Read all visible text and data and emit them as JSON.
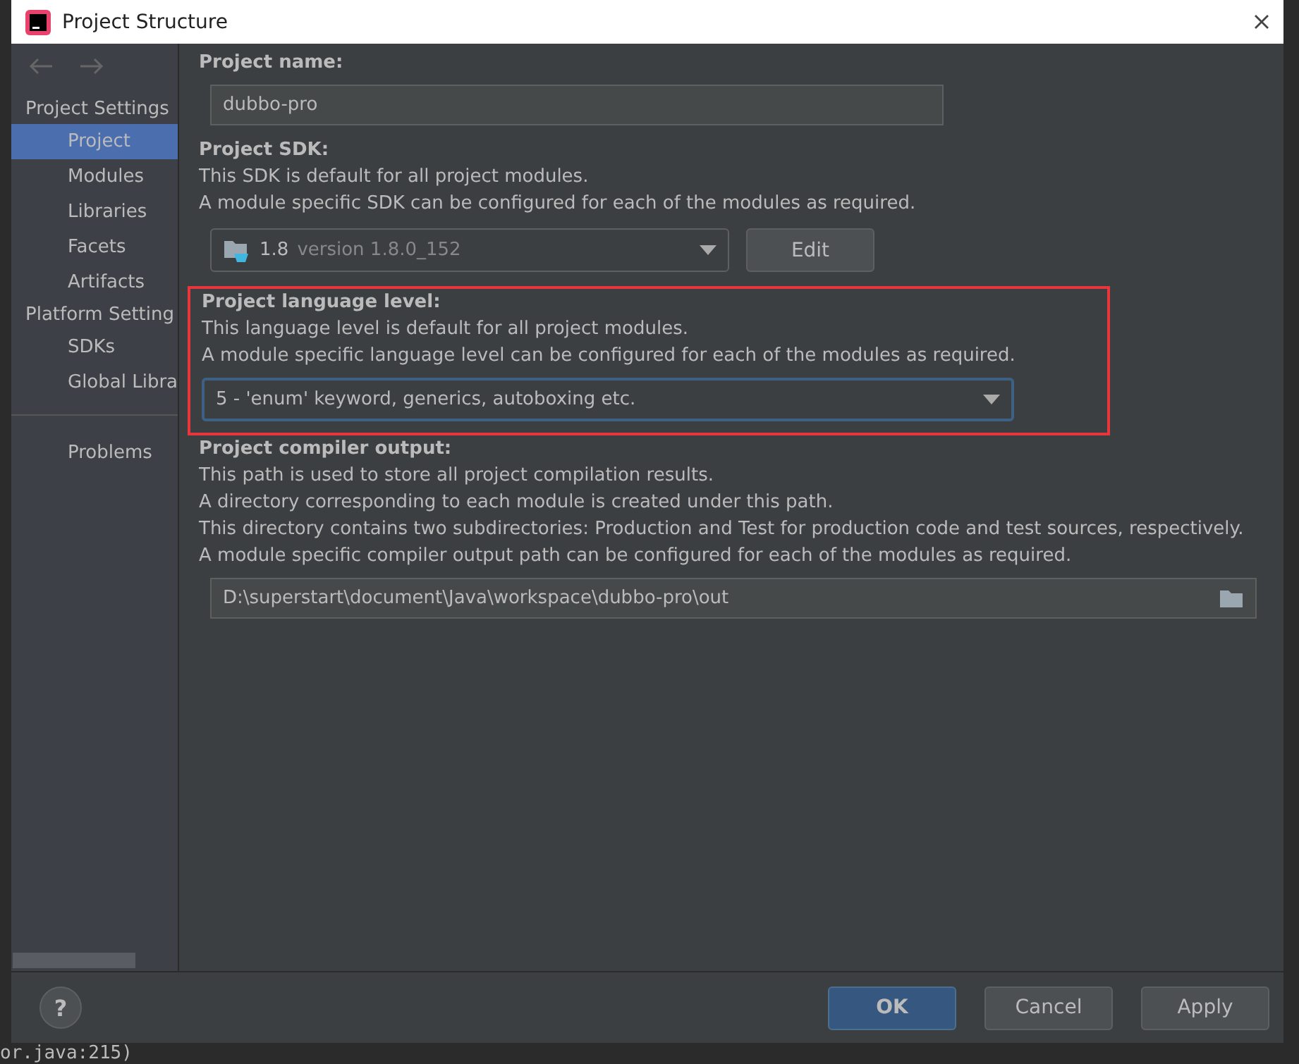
{
  "window": {
    "title": "Project Structure"
  },
  "sidebar": {
    "sections": [
      {
        "title": "Project Settings",
        "items": [
          {
            "label": "Project",
            "selected": true
          },
          {
            "label": "Modules",
            "selected": false
          },
          {
            "label": "Libraries",
            "selected": false
          },
          {
            "label": "Facets",
            "selected": false
          },
          {
            "label": "Artifacts",
            "selected": false
          }
        ]
      },
      {
        "title": "Platform Setting",
        "items": [
          {
            "label": "SDKs",
            "selected": false
          },
          {
            "label": "Global Libra",
            "selected": false
          }
        ]
      },
      {
        "items": [
          {
            "label": "Problems",
            "selected": false
          }
        ]
      }
    ]
  },
  "project_name": {
    "label": "Project name:",
    "value": "dubbo-pro"
  },
  "project_sdk": {
    "label": "Project SDK:",
    "lines": [
      "This SDK is default for all project modules.",
      "A module specific SDK can be configured for each of the modules as required."
    ],
    "sdk_name": "1.8",
    "sdk_version": "version 1.8.0_152",
    "edit_button": "Edit"
  },
  "language_level": {
    "label": "Project language level:",
    "lines": [
      "This language level is default for all project modules.",
      "A module specific language level can be configured for each of the modules as required."
    ],
    "value": "5 - 'enum' keyword, generics, autoboxing etc.",
    "highlighted": true
  },
  "compiler_output": {
    "label": "Project compiler output:",
    "lines": [
      "This path is used to store all project compilation results.",
      "A directory corresponding to each module is created under this path.",
      "This directory contains two subdirectories: Production and Test for production code and test sources, respectively.",
      "A module specific compiler output path can be configured for each of the modules as required."
    ],
    "value": "D:\\superstart\\document\\Java\\workspace\\dubbo-pro\\out"
  },
  "help_button": "?",
  "buttons": [
    {
      "label": "OK",
      "kind": "primary"
    },
    {
      "label": "Cancel",
      "kind": "plain"
    },
    {
      "label": "Apply",
      "kind": "plain"
    }
  ],
  "background_text": "or.java:215)"
}
